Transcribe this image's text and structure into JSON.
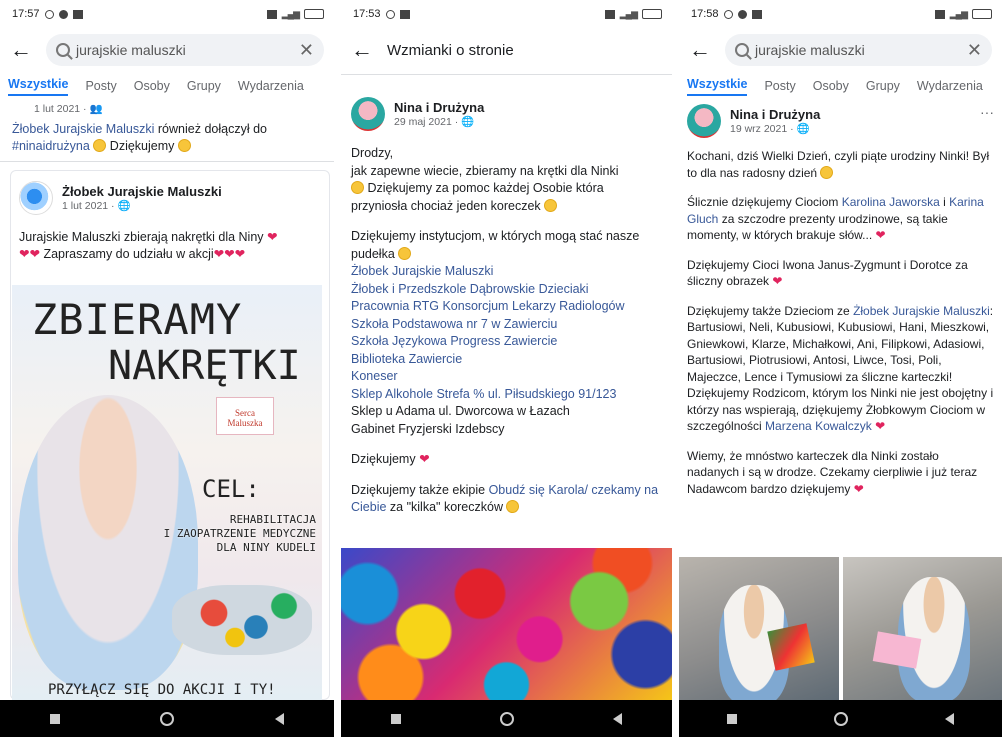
{
  "screen1": {
    "status_time": "17:57",
    "search_value": "jurajskie maluszki",
    "tabs": [
      "Wszystkie",
      "Posty",
      "Osoby",
      "Grupy",
      "Wydarzenia"
    ],
    "prev_meta": "1 lut 2021 · 👥",
    "prev_link": "Żłobek Jurajskie Maluszki",
    "prev_text": " również dołączył do",
    "prev_hashtag": "#ninaidrużyna",
    "prev_thanks": " Dziękujemy",
    "post_author": "Żłobek Jurajskie Maluszki",
    "post_meta": "1 lut 2021 · 🌐",
    "post_text_1": "Jurajskie Maluszki zbierają nakrętki dla Niny",
    "post_text_2": "Zapraszamy do udziału w akcji",
    "poster_line1": "ZBIERAMY",
    "poster_line2": "NAKRĘTKI",
    "poster_cel": "CEL:",
    "poster_goal_1": "REHABILITACJA",
    "poster_goal_2": "I ZAOPATRZENIE MEDYCZNE",
    "poster_goal_3": "DLA NINY KUDELI",
    "poster_logo": "Serca Maluszka",
    "poster_footer": "PRZYŁĄCZ SIĘ DO AKCJI I TY!"
  },
  "screen2": {
    "status_time": "17:53",
    "title": "Wzmianki o stronie",
    "post_author": "Nina i Drużyna",
    "post_meta": "29 maj 2021 · 🌐",
    "p1": "Drodzy,",
    "p2": "jak zapewne wiecie, zbieramy na krętki dla Ninki",
    "p3": " Dziękujemy za pomoc każdej Osobie która przyniosła chociaż jeden koreczek",
    "p4": "Dziękujemy instytucjom, w których mogą stać nasze pudełka",
    "links": [
      "Żłobek Jurajskie Maluszki",
      "Żłobek i Przedszkole Dąbrowskie Dzieciaki",
      "Pracownia RTG Konsorcjum Lekarzy Radiologów",
      "Szkoła Podstawowa nr 7 w Zawierciu",
      "Szkoła Językowa Progress Zawiercie",
      "Biblioteka Zawiercie",
      "Koneser",
      "Sklep Alkohole Strefa % ul. Piłsudskiego 91/123"
    ],
    "plain_1": "Sklep u Adama ul. Dworcowa w Łazach",
    "plain_2": "Gabinet Fryzjerski Izdebscy",
    "thanks": "Dziękujemy",
    "last_prefix": "Dziękujemy także ekipie ",
    "last_link": "Obudź się Karola/ czekamy na Ciebie",
    "last_suffix": " za \"kilka\" koreczków"
  },
  "screen3": {
    "status_time": "17:58",
    "search_value": "jurajskie maluszki",
    "tabs": [
      "Wszystkie",
      "Posty",
      "Osoby",
      "Grupy",
      "Wydarzenia"
    ],
    "post_author": "Nina i Drużyna",
    "post_meta": "19 wrz 2021 · 🌐",
    "more": "···",
    "t1": "Kochani, dziś Wielki Dzień, czyli piąte urodziny Ninki! Był to dla nas radosny dzień",
    "t2_a": "Ślicznie dziękujemy Ciociom ",
    "t2_link1": "Karolina Jaworska",
    "t2_b": " i ",
    "t2_link2": "Karina Gluch",
    "t2_c": " za szczodre prezenty urodzinowe, są takie momenty, w których brakuje słów...",
    "t3": "Dziękujemy Cioci Iwona Janus-Zygmunt i Dorotce za śliczny obrazek",
    "t4_a": "Dziękujemy także Dzieciom ze ",
    "t4_link": "Żłobek Jurajskie Maluszki",
    "t4_b": ": Bartusiowi, Neli, Kubusiowi, Kubusiowi, Hani, Mieszkowi, Gniewkowi, Klarze, Michałkowi, Ani, Filipkowi, Adasiowi, Bartusiowi, Piotrusiowi, Antosi, Liwce, Tosi, Poli, Majeczce, Lence i Tymusiowi za śliczne karteczki! Dziękujemy Rodzicom, którym los Ninki nie jest obojętny i którzy nas wspierają, dziękujemy Żłobkowym Ciociom w szczególności ",
    "t4_link2": "Marzena Kowalczyk",
    "t5": "Wiemy, że mnóstwo karteczek dla Ninki zostało nadanych i są w drodze. Czekamy cierpliwie i już teraz Nadawcom bardzo dziękujemy"
  },
  "colors": {
    "link": "#385898",
    "active_tab": "#1877f2",
    "heart": "#e0245e"
  }
}
